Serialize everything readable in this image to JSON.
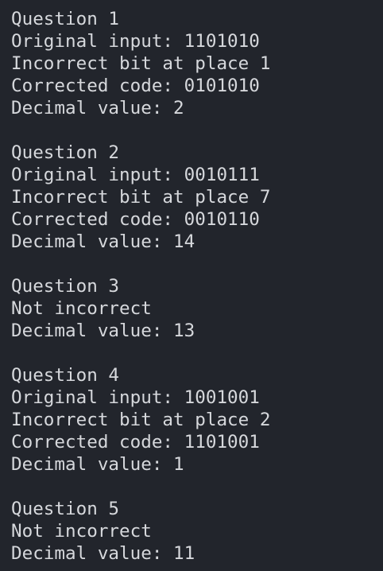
{
  "terminal": {
    "questions": [
      {
        "heading": "Question 1",
        "lines": [
          "Original input: 1101010",
          "Incorrect bit at place 1",
          "Corrected code: 0101010",
          "Decimal value: 2"
        ]
      },
      {
        "heading": "Question 2",
        "lines": [
          "Original input: 0010111",
          "Incorrect bit at place 7",
          "Corrected code: 0010110",
          "Decimal value: 14"
        ]
      },
      {
        "heading": "Question 3",
        "lines": [
          "Not incorrect",
          "Decimal value: 13"
        ]
      },
      {
        "heading": "Question 4",
        "lines": [
          "Original input: 1001001",
          "Incorrect bit at place 2",
          "Corrected code: 1101001",
          "Decimal value: 1"
        ]
      },
      {
        "heading": "Question 5",
        "lines": [
          "Not incorrect",
          "Decimal value: 11"
        ]
      }
    ]
  },
  "colors": {
    "background": "#22252c",
    "text": "#d6d8dc"
  }
}
